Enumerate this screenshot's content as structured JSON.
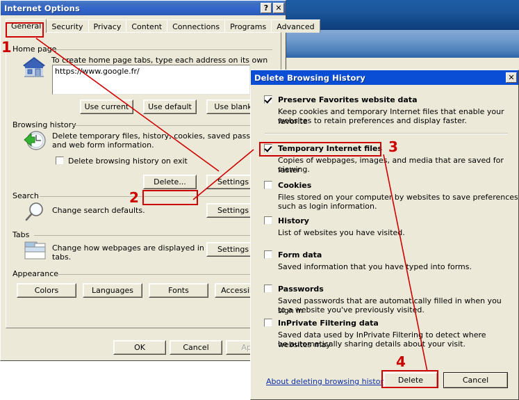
{
  "internet_options": {
    "title": "Internet Options",
    "help_button": "?",
    "close_button": "✕",
    "tabs": [
      {
        "label": "General",
        "active": true
      },
      {
        "label": "Security",
        "active": false
      },
      {
        "label": "Privacy",
        "active": false
      },
      {
        "label": "Content",
        "active": false
      },
      {
        "label": "Connections",
        "active": false
      },
      {
        "label": "Programs",
        "active": false
      },
      {
        "label": "Advanced",
        "active": false
      }
    ],
    "home_page": {
      "group_label": "Home page",
      "hint": "To create home page tabs, type each address on its own line.",
      "value": "https://www.google.fr/",
      "buttons": [
        "Use current",
        "Use default",
        "Use blank"
      ]
    },
    "browsing_history": {
      "group_label": "Browsing history",
      "desc_line1": "Delete temporary files, history, cookies, saved passwords,",
      "desc_line2": "and web form information.",
      "checkbox_label": "Delete browsing history on exit",
      "checkbox_checked": false,
      "delete_button": "Delete...",
      "settings_button": "Settings"
    },
    "search": {
      "group_label": "Search",
      "desc": "Change search defaults.",
      "settings_button": "Settings"
    },
    "tabs_section": {
      "group_label": "Tabs",
      "desc_line1": "Change how webpages are displayed in",
      "desc_line2": "tabs.",
      "settings_button": "Settings"
    },
    "appearance": {
      "group_label": "Appearance",
      "buttons": [
        "Colors",
        "Languages",
        "Fonts",
        "Accessibility"
      ]
    },
    "footer_buttons": [
      {
        "label": "OK",
        "disabled": false
      },
      {
        "label": "Cancel",
        "disabled": false
      },
      {
        "label": "Apply",
        "disabled": true
      }
    ]
  },
  "delete_browsing_history": {
    "title": "Delete Browsing History",
    "close_button": "✕",
    "items": [
      {
        "label": "Preserve Favorites website data",
        "checked": true,
        "desc_line1": "Keep cookies and temporary Internet files that enable your favorite",
        "desc_line2": "websites to retain preferences and display faster."
      },
      {
        "label": "Temporary Internet files",
        "checked": true,
        "desc_line1": "Copies of webpages, images, and media that are saved for faster",
        "desc_line2": "viewing."
      },
      {
        "label": "Cookies",
        "checked": false,
        "desc_line1": "Files stored on your computer by websites to save preferences",
        "desc_line2": "such as login information."
      },
      {
        "label": "History",
        "checked": false,
        "desc_line1": "List of websites you have visited.",
        "desc_line2": ""
      },
      {
        "label": "Form data",
        "checked": false,
        "desc_line1": "Saved information that you have typed into forms.",
        "desc_line2": ""
      },
      {
        "label": "Passwords",
        "checked": false,
        "desc_line1": "Saved passwords that are automatically filled in when you sign in",
        "desc_line2": "to a website you've previously visited."
      },
      {
        "label": "InPrivate Filtering data",
        "checked": false,
        "desc_line1": "Saved data used by InPrivate Filtering to detect where websites may",
        "desc_line2": "be automatically sharing details about your visit."
      }
    ],
    "about_link": "About deleting browsing history",
    "delete_button": "Delete",
    "cancel_button": "Cancel"
  },
  "annotations": {
    "color": "#cc0000",
    "steps": [
      {
        "number": "1",
        "target": "General tab"
      },
      {
        "number": "2",
        "target": "Delete... button"
      },
      {
        "number": "3",
        "target": "Temporary Internet files checkbox"
      },
      {
        "number": "4",
        "target": "Delete button"
      }
    ]
  }
}
